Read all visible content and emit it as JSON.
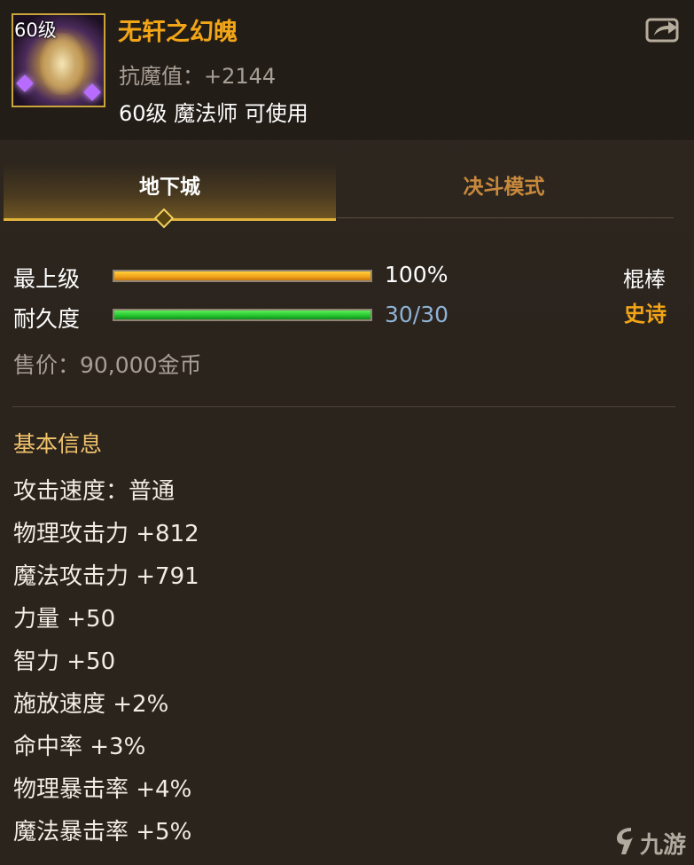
{
  "header": {
    "level_badge": "60级",
    "item_name": "无轩之幻魄",
    "anti_magic": "抗魔值：+2144",
    "usable_by": "60级 魔法师 可使用"
  },
  "tabs": [
    {
      "label": "地下城",
      "active": true
    },
    {
      "label": "决斗模式",
      "active": false
    }
  ],
  "grade": {
    "label": "最上级",
    "value": "100%",
    "fill": 1.0
  },
  "durability": {
    "label": "耐久度",
    "value": "30/30",
    "fill": 1.0
  },
  "weapon_type": "棍棒",
  "rarity": "史诗",
  "price": "售价：90,000金币",
  "section_title": "基本信息",
  "stats": [
    "攻击速度：普通",
    "物理攻击力 +812",
    "魔法攻击力 +791",
    "力量 +50",
    "智力 +50",
    "施放速度 +2%",
    "命中率 +3%",
    "物理暴击率 +4%",
    "魔法暴击率 +5%"
  ],
  "watermark": "九游",
  "colors": {
    "item_name": "#f2a516",
    "rarity": "#f2a516",
    "durability_text": "#8fb3d6",
    "section_title": "#f1c36b"
  },
  "icons": {
    "share": "share-icon",
    "tab_marker": "diamond-icon",
    "watermark_logo": "jiuyou-logo-icon"
  }
}
